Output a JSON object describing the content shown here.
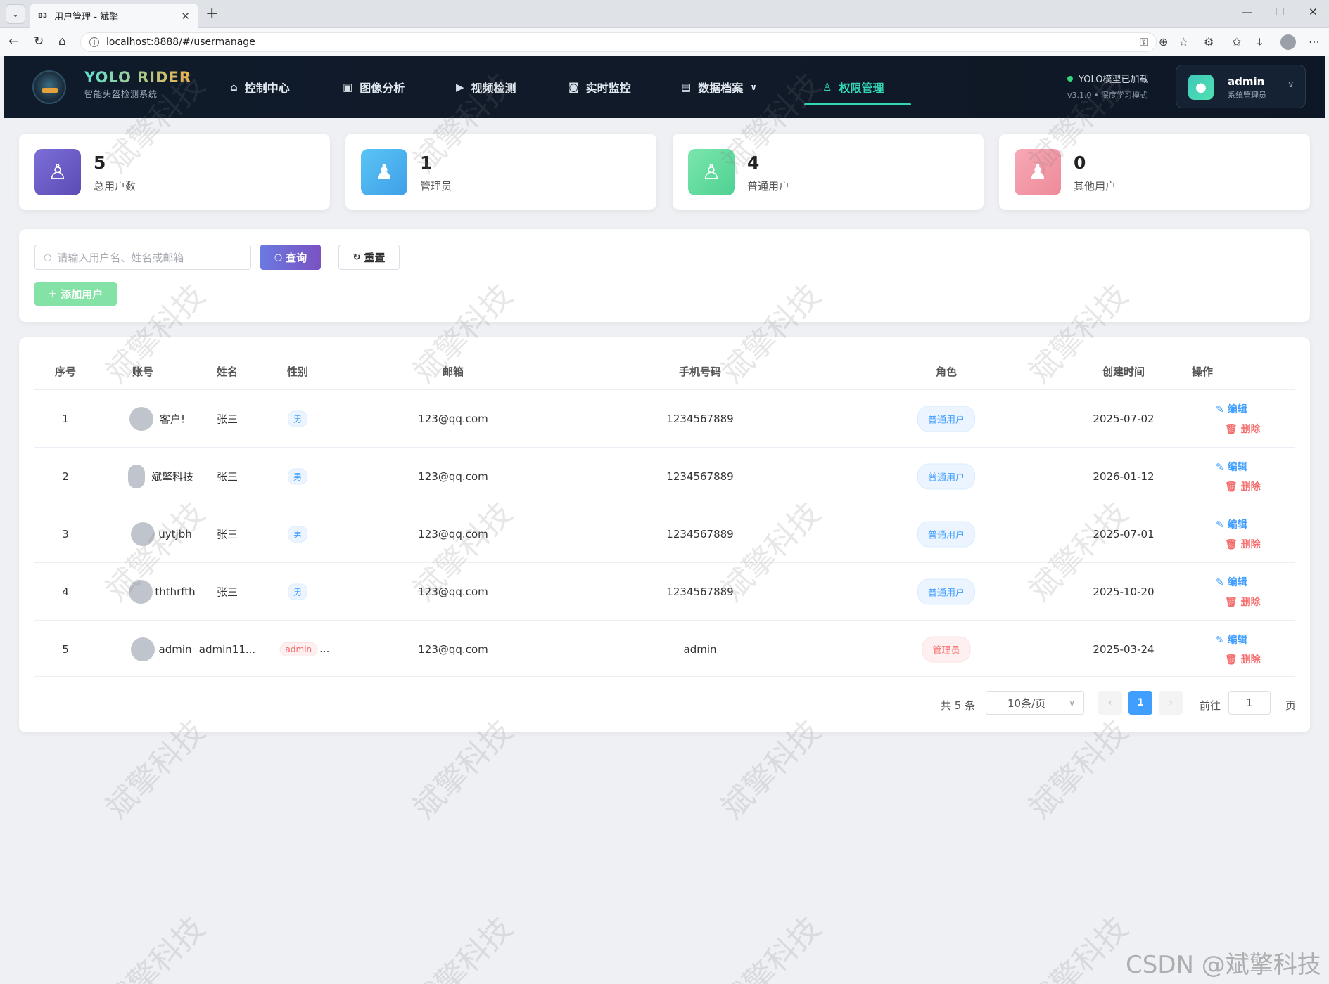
{
  "browser": {
    "tab_title": "用户管理 - 斌擎",
    "tab_favicon": "B3",
    "url": "localhost:8888/#/usermanage"
  },
  "header": {
    "brand_name": "YOLO RIDER",
    "brand_sub": "智能头盔检测系统",
    "nav": [
      {
        "label": "控制中心",
        "icon": "home-icon"
      },
      {
        "label": "图像分析",
        "icon": "image-icon"
      },
      {
        "label": "视频检测",
        "icon": "play-icon"
      },
      {
        "label": "实时监控",
        "icon": "camera-icon"
      },
      {
        "label": "数据档案",
        "icon": "document-icon"
      },
      {
        "label": "权限管理",
        "icon": "user-icon"
      }
    ],
    "active_nav": "权限管理",
    "model_status": "YOLO模型已加载",
    "model_version": "v3.1.0 • 深度学习模式",
    "user_name": "admin",
    "user_role": "系统管理员"
  },
  "stats": [
    {
      "value": "5",
      "label": "总用户数",
      "color": "#6b5fc7"
    },
    {
      "value": "1",
      "label": "管理员",
      "color": "#4fb3f0"
    },
    {
      "value": "4",
      "label": "普通用户",
      "color": "#5fdc9c"
    },
    {
      "value": "0",
      "label": "其他用户",
      "color": "#f29aa8"
    }
  ],
  "search": {
    "placeholder": "请输入用户名、姓名或邮箱",
    "query_label": "查询",
    "reset_label": "重置",
    "add_label": "添加用户"
  },
  "table": {
    "headers": [
      "序号",
      "账号",
      "姓名",
      "性别",
      "邮箱",
      "手机号码",
      "角色",
      "创建时间",
      "操作"
    ],
    "rows": [
      {
        "index": "1",
        "account": "客户!",
        "name": "张三",
        "gender": "男",
        "email": "123@qq.com",
        "phone": "1234567889",
        "role": "普通用户",
        "created": "2025-07-02"
      },
      {
        "index": "2",
        "account": "斌擎科技",
        "name": "张三",
        "gender": "男",
        "email": "123@qq.com",
        "phone": "1234567889",
        "role": "普通用户",
        "created": "2026-01-12"
      },
      {
        "index": "3",
        "account": "uytjbh",
        "name": "张三",
        "gender": "男",
        "email": "123@qq.com",
        "phone": "1234567889",
        "role": "普通用户",
        "created": "2025-07-01"
      },
      {
        "index": "4",
        "account": "ththrfth",
        "name": "张三",
        "gender": "男",
        "email": "123@qq.com",
        "phone": "1234567889",
        "role": "普通用户",
        "created": "2025-10-20"
      },
      {
        "index": "5",
        "account": "admin",
        "name": "admin11...",
        "gender": "admin",
        "gender_ellipsis": "...",
        "email": "123@qq.com",
        "phone": "admin",
        "role": "管理员",
        "created": "2025-03-24"
      }
    ],
    "edit_label": "编辑",
    "delete_label": "删除"
  },
  "pagination": {
    "total": "共 5 条",
    "page_size": "10条/页",
    "current": "1",
    "goto_label": "前往",
    "goto_value": "1",
    "page_suffix": "页"
  },
  "watermark": "斌擎科技",
  "csdn_mark": "CSDN @斌擎科技"
}
